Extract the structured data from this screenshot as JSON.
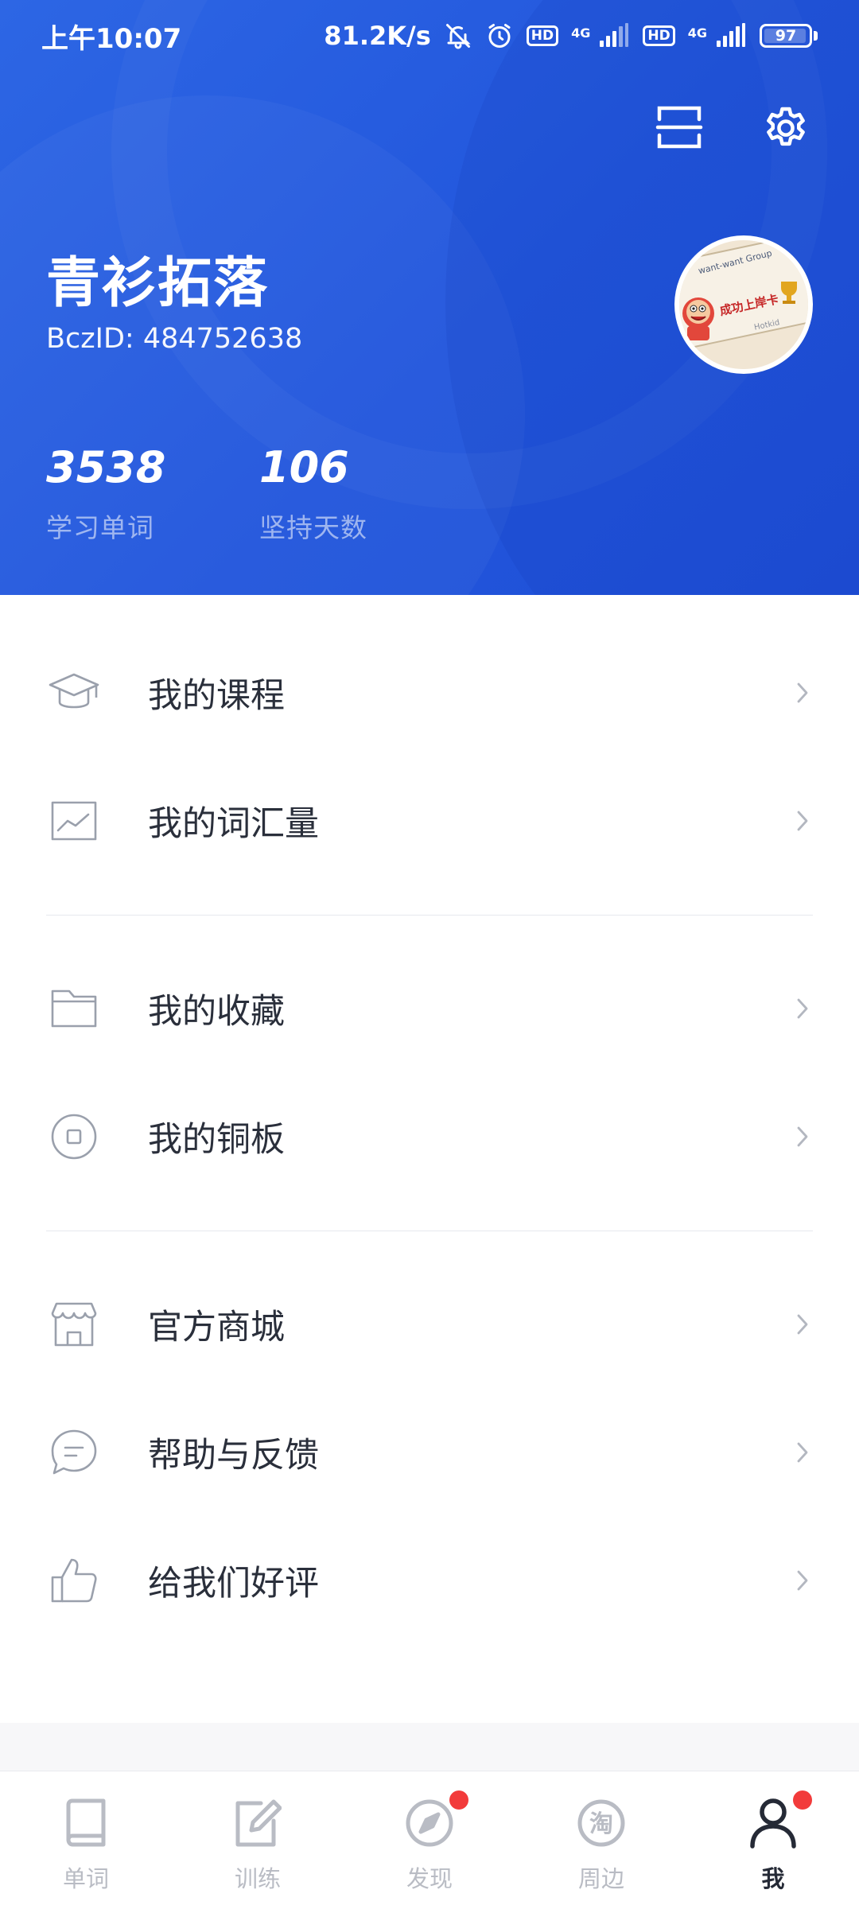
{
  "status_bar": {
    "time": "上午10:07",
    "speed": "81.2K/s",
    "hd_1": "HD",
    "net_1": "4G",
    "hd_2": "HD",
    "net_2": "4G",
    "battery": "97",
    "battery_level": 0.97,
    "icons": [
      "mute-icon",
      "alarm-icon",
      "hd-icon",
      "signal-icon",
      "hd-icon",
      "signal-icon",
      "battery-icon"
    ]
  },
  "header": {
    "scan_icon": "scan-icon",
    "settings_icon": "gear-icon",
    "user_name": "青衫拓落",
    "user_id": "BczID: 484752638",
    "avatar": {
      "label_top": "want-want Group",
      "label_main": "成功上岸卡",
      "label_bottom": "Hotkid"
    },
    "stats": [
      {
        "value": "3538",
        "label": "学习单词"
      },
      {
        "value": "106",
        "label": "坚持天数"
      }
    ],
    "bg_color": "#2458dd"
  },
  "menu": {
    "groups": [
      {
        "items": [
          {
            "label": "我的课程",
            "icon": "graduation-cap-icon"
          },
          {
            "label": "我的词汇量",
            "icon": "chart-icon"
          }
        ]
      },
      {
        "items": [
          {
            "label": "我的收藏",
            "icon": "folder-icon"
          },
          {
            "label": "我的铜板",
            "icon": "coin-icon"
          }
        ]
      },
      {
        "items": [
          {
            "label": "官方商城",
            "icon": "store-icon"
          },
          {
            "label": "帮助与反馈",
            "icon": "chat-icon"
          },
          {
            "label": "给我们好评",
            "icon": "thumbs-up-icon"
          }
        ]
      }
    ]
  },
  "tabbar": {
    "tabs": [
      {
        "label": "单词",
        "icon": "book-icon",
        "active": false,
        "badge": false
      },
      {
        "label": "训练",
        "icon": "edit-icon",
        "active": false,
        "badge": false
      },
      {
        "label": "发现",
        "icon": "compass-icon",
        "active": false,
        "badge": true
      },
      {
        "label": "周边",
        "icon": "tao-icon",
        "glyph": "淘",
        "active": false,
        "badge": true
      },
      {
        "label": "我",
        "icon": "person-icon",
        "active": true,
        "badge": true
      }
    ],
    "active_color": "#252a36",
    "inactive_color": "#b9bcc4",
    "badge_color": "#f23b3b"
  }
}
